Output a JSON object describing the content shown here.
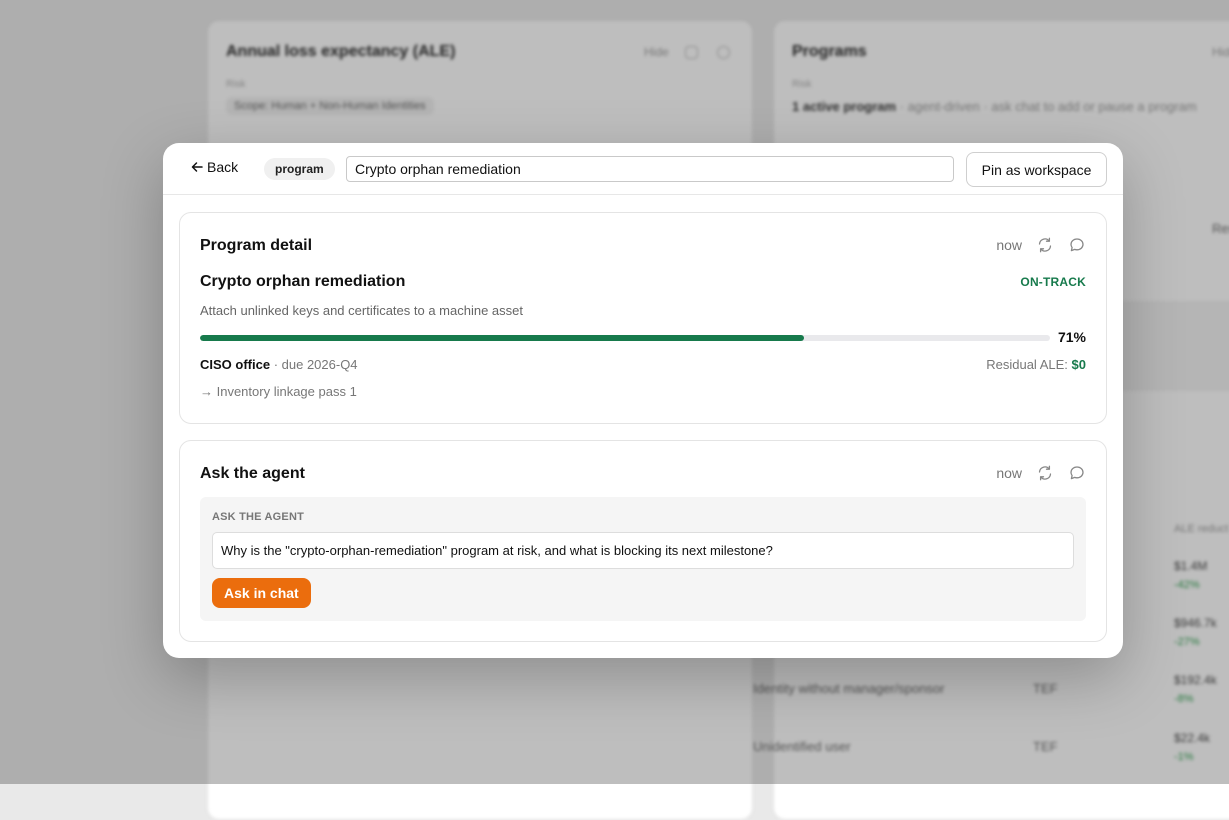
{
  "background": {
    "ale_card": {
      "title": "Annual loss expectancy (ALE)",
      "action": "Hide",
      "filter_label": "Risk",
      "chip": "Scope: Human + Non-Human Identities"
    },
    "programs_card": {
      "title": "Programs",
      "action": "Hide",
      "filter_label": "Risk",
      "summary_bold": "1 active program",
      "summary_rest": "· agent-driven · ask chat to add or pause a program",
      "label_a": "Residual",
      "col_header": "ALE reduct",
      "rows": [
        {
          "name": "",
          "tag": "",
          "value": "$1.4M",
          "delta": "-42%"
        },
        {
          "name": "",
          "tag": "",
          "value": "$946.7k",
          "delta": "-27%"
        },
        {
          "name": "Identity without manager/sponsor",
          "tag": "TEF",
          "value": "$192.4k",
          "delta": "-8%"
        },
        {
          "name": "Unidentified user",
          "tag": "TEF",
          "value": "$22.4k",
          "delta": "-1%"
        }
      ]
    }
  },
  "modal": {
    "back_label": "Back",
    "kind_chip": "program",
    "title_value": "Crypto orphan remediation",
    "pin_label": "Pin as workspace",
    "detail_panel": {
      "title": "Program detail",
      "timestamp": "now",
      "program_name": "Crypto orphan remediation",
      "status": "ON-TRACK",
      "description": "Attach unlinked keys and certificates to a machine asset",
      "progress_pct": 71,
      "progress_label": "71%",
      "owner": "CISO office",
      "due": "· due 2026-Q4",
      "residual_label": "Residual ALE:",
      "residual_value": "$0",
      "milestone": "→ Inventory linkage pass 1"
    },
    "ask_panel": {
      "title": "Ask the agent",
      "timestamp": "now",
      "box_label": "ASK THE AGENT",
      "question": "Why is the \"crypto-orphan-remediation\" program at risk, and what is blocking its next milestone?",
      "button_label": "Ask in chat"
    }
  },
  "colors": {
    "accent_green": "#177a4c",
    "accent_orange": "#eb6d0d"
  },
  "icons": [
    "back-arrow-icon",
    "refresh-icon",
    "comment-icon",
    "edit-icon"
  ]
}
